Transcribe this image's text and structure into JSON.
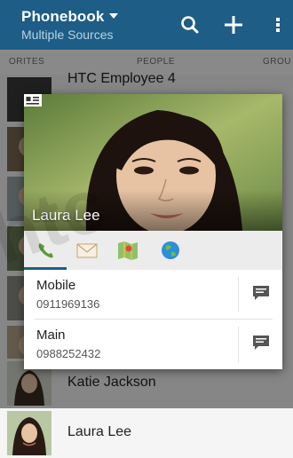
{
  "header": {
    "title": "Phonebook",
    "subtitle": "Multiple Sources",
    "search_icon": "search-icon",
    "add_icon": "plus-icon",
    "menu_icon": "overflow-menu-icon"
  },
  "tabs": [
    {
      "label": "ORITES"
    },
    {
      "label": "PEOPLE"
    },
    {
      "label": "GROU"
    }
  ],
  "list": [
    {
      "name": "HTC Employee 4"
    },
    {
      "name": "Katie Jackson"
    },
    {
      "name": "Laura Lee"
    }
  ],
  "popup": {
    "name": "Laura Lee",
    "actions": [
      {
        "icon": "phone-icon"
      },
      {
        "icon": "mail-icon"
      },
      {
        "icon": "map-icon"
      },
      {
        "icon": "globe-icon"
      }
    ],
    "entries": [
      {
        "label": "Mobile",
        "value": "0911969136"
      },
      {
        "label": "Main",
        "value": "0988252432"
      }
    ]
  },
  "colors": {
    "accent": "#1d5d86"
  }
}
